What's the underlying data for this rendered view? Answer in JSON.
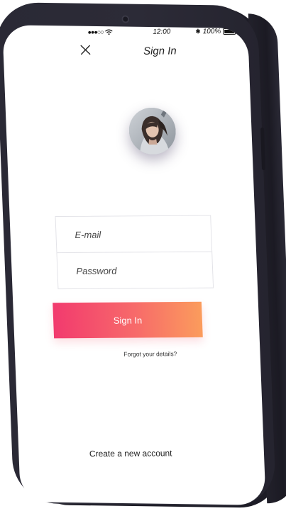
{
  "status_bar": {
    "time": "12:00",
    "battery": "100%",
    "icons": [
      "signal-icon",
      "wifi-icon",
      "bluetooth-icon",
      "battery-icon"
    ]
  },
  "nav": {
    "title": "Sign In",
    "close_icon": "close-icon"
  },
  "form": {
    "email_placeholder": "E-mail",
    "password_placeholder": "Password",
    "submit_label": "Sign In",
    "forgot_label": "Forgot your details?"
  },
  "footer": {
    "create_account_label": "Create a new account"
  },
  "colors": {
    "device_body": "#2b2a36",
    "button_gradient_start": "#f23a6e",
    "button_gradient_end": "#fb9c5c",
    "screen_bg": "#ffffff"
  }
}
